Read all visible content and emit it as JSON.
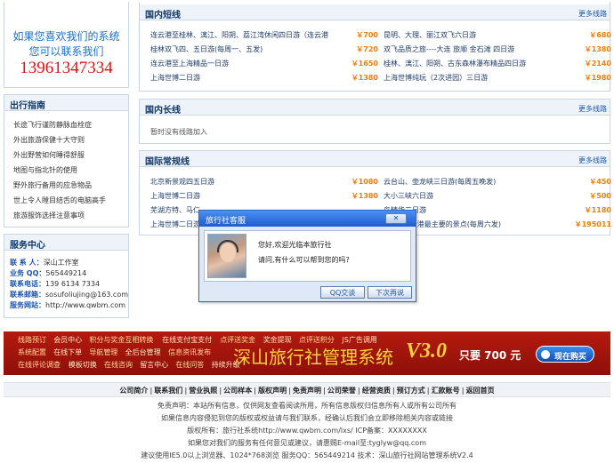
{
  "contact": {
    "line1": "如果您喜欢我们的系统",
    "line2": "您可以联系我们",
    "phone": "13961347334"
  },
  "guide": {
    "title": "出行指南",
    "items": [
      "长途飞行谨防静脉血栓症",
      "外出旅游保健十大守则",
      "外出野营如何睡得舒服",
      "地图与指北针的使用",
      "野外旅行备用的应急物品",
      "世上令人瞠目结舌的电脑高手",
      "旅游服饰选择注意事项"
    ]
  },
  "service": {
    "title": "服务中心",
    "rows": [
      {
        "label": "联 系 人：",
        "value": "深山工作室"
      },
      {
        "label": "业务 QQ：",
        "value": "565449214"
      },
      {
        "label": "联系电话：",
        "value": "139 6134 7334"
      },
      {
        "label": "联系邮箱：",
        "value": "sosufoliujing@163.com"
      },
      {
        "label": "服务网站：",
        "value": "http://www.qwbm.com"
      }
    ]
  },
  "domestic_short": {
    "title": "国内短线",
    "more": "更多线路",
    "left": [
      {
        "name": "连云港至桂林、漓江、阳朔、荔江湾休闲四日游（连云港",
        "price": "￥700"
      },
      {
        "name": "桂林双飞四、五日游(每周一、五发)",
        "price": "￥720"
      },
      {
        "name": "连云港至上海精品一日游",
        "price": "￥1650"
      },
      {
        "name": "上海世博二日游",
        "price": "￥1380"
      }
    ],
    "right": [
      {
        "name": "昆明、大理、丽江双飞六日游",
        "price": "￥680"
      },
      {
        "name": "双飞品质之旅----大连 旅顺 金石滩 四日游",
        "price": "￥1380"
      },
      {
        "name": "桂林、漓江、阳朔、古东森林瀑布精品四日游",
        "price": "￥2140"
      },
      {
        "name": "上海世博纯玩（2次进园）三日游",
        "price": "￥1980"
      }
    ]
  },
  "domestic_long": {
    "title": "国内长线",
    "more": "更多线路",
    "empty": "暂时没有线路加入"
  },
  "international": {
    "title": "国际常规线",
    "more": "更多线路",
    "left": [
      {
        "name": "北京新景观四五日游",
        "price": "￥1080"
      },
      {
        "name": "上海世博二日游",
        "price": "￥1380"
      },
      {
        "name": "芜湖方特、马仁",
        "price": ""
      },
      {
        "name": "上海世博二日游",
        "price": ""
      }
    ],
    "right": [
      {
        "name": "云台山、壶龙峡三日游(每周五晚发)",
        "price": "￥450"
      },
      {
        "name": "大小三峡六日游",
        "price": "￥500"
      },
      {
        "name": "岛精华二日游",
        "price": "￥1180"
      },
      {
        "name": "日游--连云港最主要的景点(每周六发)",
        "price": "￥195011"
      }
    ]
  },
  "dialog": {
    "title": "旅行社客服",
    "greeting": "您好,欢迎光临本旅行社",
    "question": "请问,有什么可以帮到您的吗?",
    "btn_qq": "QQ交谈",
    "btn_later": "下次再说",
    "close": "✕"
  },
  "banner": {
    "links_row1": [
      "线路预订",
      "会员中心",
      "积分与奖金互相转换",
      "在线支付宝支付",
      "点评送奖金",
      "奖金提现",
      "点评送积分",
      "JS广告调用"
    ],
    "links_row2": [
      "系统配置",
      "在线下单",
      "导航管理",
      "全后台管理",
      "信息资讯发布"
    ],
    "links_row3": [
      "在线评论调查",
      "模板切换",
      "在线咨询",
      "留言中心",
      "在线问答",
      "持续升级"
    ],
    "product": "深山旅行社管理系统",
    "version": "V3.0",
    "price_text": "只要 700 元",
    "buy": "现在购买"
  },
  "footer": {
    "nav": [
      "公司简介",
      "联系我们",
      "营业执照",
      "公司样本",
      "版权声明",
      "免责声明",
      "公司荣誉",
      "经营资质",
      "预订方式",
      "汇款账号",
      "返回首页"
    ],
    "lines": [
      "免责声明：本站所有信息，仅供网友查看阅读所用，所有信息版权归信息所有人或所有公司所有",
      "如果信息内容侵犯到您的版权或权益请与我们联系，经确认后我们会立即移除相关内容或链接",
      "版权所有：旅行社系统http://www.qwbm.com/lxs/ ICP备案：XXXXXXXX",
      "如果您对我们的服务有任何意见或建议，请惠赐E-mail至:tyglyw@qq.com",
      "建议使用IE5.0以上浏览器、1024*768浏览 服务QQ：565449214 技术：深山旅行社网站管理系统V2.4"
    ]
  }
}
